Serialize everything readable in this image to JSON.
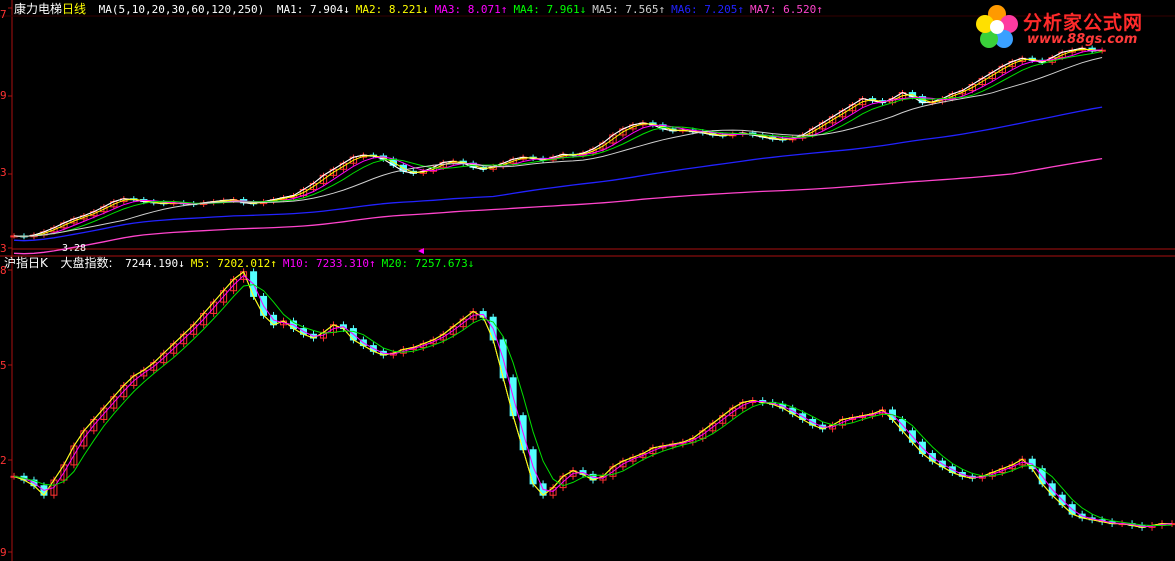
{
  "colors": {
    "background": "#000000",
    "frame": "#aa1111",
    "up_candle": "#ff3232",
    "down_candle": "#54ffff",
    "white_line": "#ffffff",
    "yellow_line": "#ffff00",
    "magenta_line": "#ff00ff",
    "green_line": "#00e000",
    "blue_line": "#2222ff",
    "pink_line": "#ff44cc"
  },
  "upper_panel": {
    "stock_name": "康力电梯",
    "period": "日线",
    "ma_params": "MA(5,10,20,30,60,120,250)",
    "indicators": [
      {
        "label": "MA1:",
        "value": "7.904",
        "arrow": "↓",
        "color": "#ffffff"
      },
      {
        "label": "MA2:",
        "value": "8.221",
        "arrow": "↓",
        "color": "#ffff00"
      },
      {
        "label": "MA3:",
        "value": "8.071",
        "arrow": "↑",
        "color": "#ff00ff"
      },
      {
        "label": "MA4:",
        "value": "7.961",
        "arrow": "↓",
        "color": "#00ff00"
      },
      {
        "label": "MA5:",
        "value": "7.565",
        "arrow": "↑",
        "color": "#d0d0d0"
      },
      {
        "label": "MA6:",
        "value": "7.205",
        "arrow": "↑",
        "color": "#2222ff"
      },
      {
        "label": "MA7:",
        "value": "6.520",
        "arrow": "↑",
        "color": "#ff44cc"
      }
    ],
    "low_marker": "3.28",
    "y_labels": [
      "7",
      "9",
      "3",
      "3"
    ]
  },
  "lower_panel": {
    "index_name": "沪指日K",
    "formula_name": "大盘指数:",
    "indicators": [
      {
        "label": "",
        "value": "7244.190",
        "arrow": "↓",
        "color": "#ffffff"
      },
      {
        "label": "M5:",
        "value": "7202.012",
        "arrow": "↑",
        "color": "#ffff00"
      },
      {
        "label": "M10:",
        "value": "7233.310",
        "arrow": "↑",
        "color": "#ff00ff"
      },
      {
        "label": "M20:",
        "value": "7257.673",
        "arrow": "↓",
        "color": "#00ff00"
      }
    ],
    "y_labels": [
      "8",
      "5",
      "2",
      "9"
    ]
  },
  "logo": {
    "name": "分析家公式网",
    "url": "www.88gs.com"
  },
  "chart_data": [
    {
      "type": "line",
      "title": "康力电梯 日线",
      "x": [
        0,
        10,
        20,
        30,
        40,
        50,
        60,
        70,
        80,
        90,
        100,
        110,
        120,
        130,
        140,
        150,
        160,
        170,
        180,
        190,
        200,
        210,
        220,
        230,
        240,
        250,
        260,
        270,
        280,
        290,
        300,
        310,
        320,
        330,
        340,
        350,
        360,
        370,
        380,
        390,
        400,
        410,
        420,
        430,
        440,
        450,
        460,
        470,
        480,
        490,
        500,
        510,
        520,
        530,
        540,
        550,
        560,
        570,
        580,
        590,
        600,
        610,
        620,
        630,
        640,
        650,
        660,
        670,
        680,
        690,
        700,
        710,
        720,
        730,
        740,
        750,
        760,
        770,
        780,
        790,
        800,
        810,
        820,
        830,
        840,
        850,
        860,
        870,
        880,
        890,
        900,
        910,
        920,
        930,
        940,
        950,
        960,
        970,
        980,
        990,
        1000,
        1010,
        1020,
        1030,
        1040,
        1050,
        1060,
        1070,
        1080,
        1090,
        1100,
        1110,
        1120,
        1130,
        1140,
        1150,
        1160
      ],
      "series": [
        {
          "name": "MA1",
          "values": [
            3.3,
            3.28,
            3.32,
            3.4,
            3.5,
            3.62,
            3.72,
            3.8,
            3.9,
            4.02,
            4.15,
            4.22,
            4.2,
            4.15,
            4.12,
            4.1,
            4.12,
            4.1,
            4.08,
            4.12,
            4.15,
            4.18,
            4.2,
            4.12,
            4.1,
            4.15,
            4.2,
            4.25,
            4.3,
            4.45,
            4.6,
            4.8,
            4.95,
            5.1,
            5.25,
            5.3,
            5.28,
            5.2,
            5.05,
            4.9,
            4.85,
            4.9,
            5.0,
            5.12,
            5.15,
            5.1,
            5.0,
            4.95,
            5.02,
            5.1,
            5.2,
            5.25,
            5.22,
            5.18,
            5.25,
            5.32,
            5.3,
            5.35,
            5.45,
            5.6,
            5.8,
            5.95,
            6.05,
            6.1,
            6.05,
            5.95,
            5.9,
            5.92,
            5.88,
            5.85,
            5.8,
            5.78,
            5.82,
            5.85,
            5.8,
            5.75,
            5.7,
            5.68,
            5.72,
            5.8,
            5.95,
            6.1,
            6.25,
            6.4,
            6.55,
            6.7,
            6.65,
            6.6,
            6.7,
            6.85,
            6.75,
            6.6,
            6.62,
            6.7,
            6.82,
            6.9,
            7.05,
            7.2,
            7.35,
            7.5,
            7.62,
            7.7,
            7.65,
            7.6,
            7.72,
            7.85,
            7.9,
            7.95,
            7.88,
            7.9
          ],
          "color": "#ffffff"
        }
      ],
      "ylim": [
        3.0,
        8.4
      ]
    },
    {
      "type": "line",
      "title": "沪指日K 大盘指数",
      "x": [
        0,
        10,
        20,
        30,
        40,
        50,
        60,
        70,
        80,
        90,
        100,
        110,
        120,
        130,
        140,
        150,
        160,
        170,
        180,
        190,
        200,
        210,
        220,
        230,
        240,
        250,
        260,
        270,
        280,
        290,
        300,
        310,
        320,
        330,
        340,
        350,
        360,
        370,
        380,
        390,
        400,
        410,
        420,
        430,
        440,
        450,
        460,
        470,
        480,
        490,
        500,
        510,
        520,
        530,
        540,
        550,
        560,
        570,
        580,
        590,
        600,
        610,
        620,
        630,
        640,
        650,
        660,
        670,
        680,
        690,
        700,
        710,
        720,
        730,
        740,
        750,
        760,
        770,
        780,
        790,
        800,
        810,
        820,
        830,
        840,
        850,
        860,
        870,
        880,
        890,
        900,
        910,
        920,
        930,
        940,
        950,
        960,
        970,
        980,
        990,
        1000,
        1010,
        1020,
        1030,
        1040,
        1050,
        1060,
        1070,
        1080,
        1090,
        1100,
        1110,
        1120,
        1130,
        1140,
        1150,
        1160
      ],
      "series": [
        {
          "name": "大盘指数",
          "values": [
            7400,
            7380,
            7350,
            7300,
            7380,
            7460,
            7560,
            7640,
            7700,
            7760,
            7820,
            7880,
            7930,
            7960,
            8000,
            8050,
            8100,
            8150,
            8200,
            8260,
            8320,
            8380,
            8440,
            8480,
            8350,
            8250,
            8200,
            8220,
            8180,
            8150,
            8130,
            8160,
            8200,
            8180,
            8120,
            8090,
            8060,
            8040,
            8050,
            8070,
            8080,
            8100,
            8120,
            8150,
            8190,
            8230,
            8270,
            8240,
            8120,
            7920,
            7720,
            7540,
            7360,
            7300,
            7340,
            7400,
            7430,
            7410,
            7380,
            7400,
            7450,
            7480,
            7500,
            7520,
            7550,
            7560,
            7570,
            7580,
            7600,
            7640,
            7680,
            7720,
            7760,
            7790,
            7800,
            7790,
            7780,
            7760,
            7730,
            7700,
            7670,
            7650,
            7670,
            7700,
            7710,
            7720,
            7730,
            7750,
            7700,
            7640,
            7580,
            7520,
            7480,
            7450,
            7420,
            7400,
            7390,
            7400,
            7420,
            7440,
            7460,
            7490,
            7440,
            7360,
            7300,
            7250,
            7200,
            7180,
            7170,
            7160,
            7150,
            7150,
            7140,
            7130,
            7140,
            7150,
            7150
          ],
          "color": "#ffffff"
        }
      ],
      "ylim": [
        7000,
        8500
      ]
    }
  ]
}
